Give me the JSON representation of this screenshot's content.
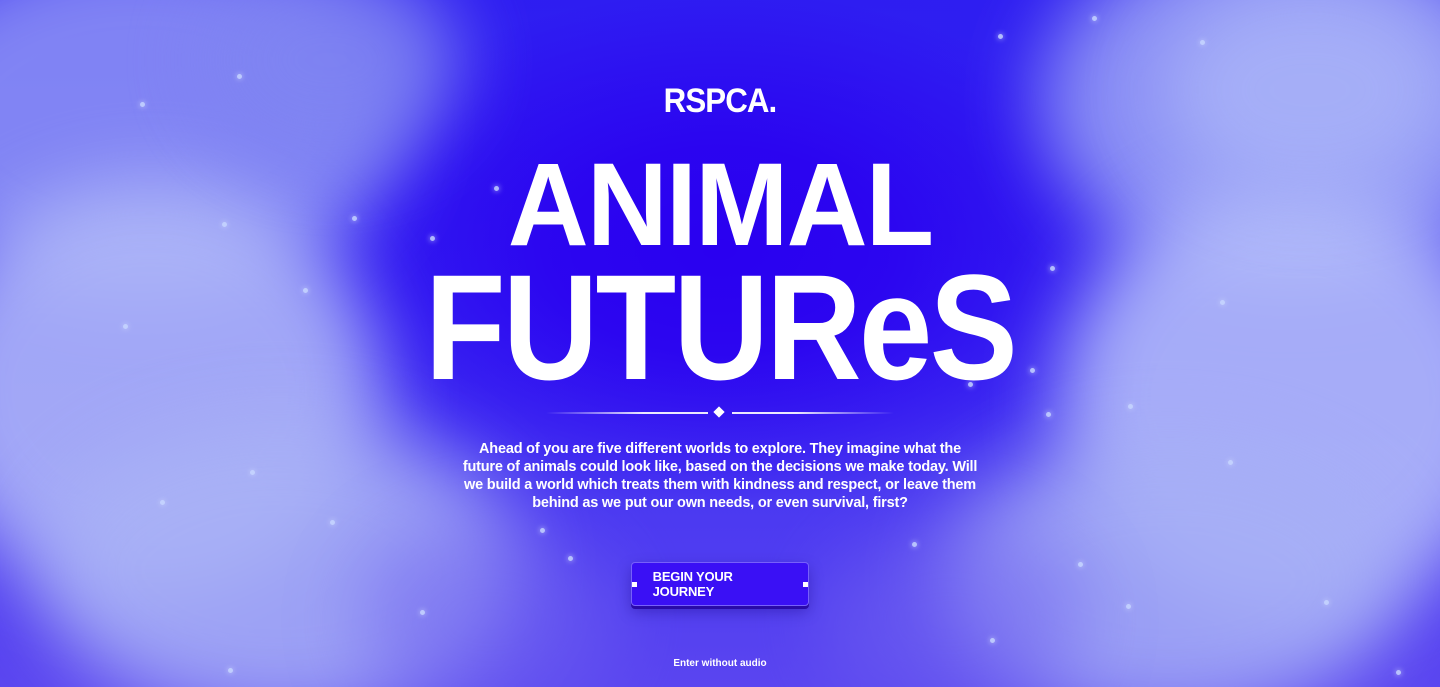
{
  "brand": {
    "logo_text": "RSPCA."
  },
  "hero": {
    "title_line_1": "ANIMAL",
    "title_line_2": "FUTUReS",
    "intro": "Ahead of you are five different worlds to explore. They imagine what the future of animals could look like, based on the decisions we make today. Will we build a world which treats them with kindness and respect, or leave them behind as we put our own needs, or even survival, first?"
  },
  "actions": {
    "begin_label": "BEGIN YOUR JOURNEY",
    "no_audio_label": "Enter without audio"
  },
  "colors": {
    "background_deep": "#2a00f0",
    "background_mid": "#3a2cf2",
    "cloud": "#b8c2fa",
    "button": "#3a10f5",
    "text": "#ffffff"
  },
  "icons": {
    "divider": "diamond-icon",
    "button_markers": "square-bullet-icon"
  }
}
